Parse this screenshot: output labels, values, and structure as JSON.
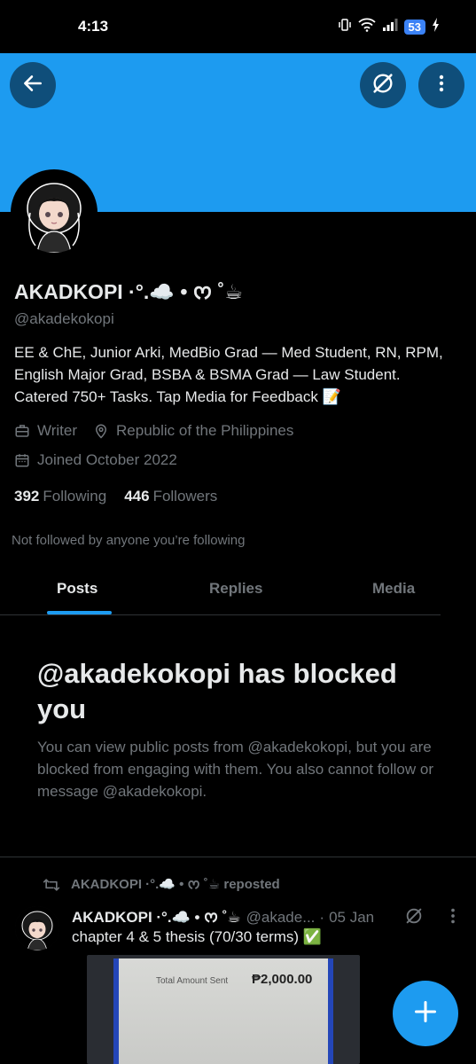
{
  "status_bar": {
    "time": "4:13",
    "battery": "53"
  },
  "banner": {
    "color": "#1d9bf0"
  },
  "profile": {
    "display_name": "AKADKOPI ·°.☁️ • ᰔ ˚☕",
    "handle": "@akadekokopi",
    "bio": "EE & ChE, Junior Arki, MedBio Grad — Med Student, RN, RPM, English Major Grad, BSBA & BSMA Grad — Law Student. Catered 750+ Tasks. Tap Media for Feedback 📝",
    "profession": "Writer",
    "location": "Republic of the Philippines",
    "joined": "Joined October 2022",
    "following_count": "392",
    "following_label": "Following",
    "followers_count": "446",
    "followers_label": "Followers",
    "not_followed_text": "Not followed by anyone you’re following"
  },
  "tabs": [
    {
      "label": "Posts",
      "active": true
    },
    {
      "label": "Replies",
      "active": false
    },
    {
      "label": "Media",
      "active": false
    }
  ],
  "blocked": {
    "title": "@akadekokopi has blocked you",
    "description": "You can view public posts from @akadekokopi, but you are blocked from engaging with them. You also cannot follow or message @akadekokopi."
  },
  "post": {
    "repost_label": "AKADKOPI ·°.☁️ • ᰔ ˚☕ reposted",
    "author": "AKADKOPI ·°.☁️ • ᰔ ˚☕",
    "handle": "@akade...",
    "separator": "·",
    "date": "05 Jan",
    "text": "chapter 4 & 5 thesis (70/30 terms) ✅",
    "media_label": "Total Amount Sent",
    "media_amount": "₱2,000.00"
  },
  "icons": {
    "back": "back-arrow-icon",
    "grok": "grok-icon",
    "more": "more-vertical-icon",
    "profession": "briefcase-icon",
    "location": "location-pin-icon",
    "joined": "calendar-icon",
    "repost": "repost-icon",
    "compose": "plus-icon"
  }
}
